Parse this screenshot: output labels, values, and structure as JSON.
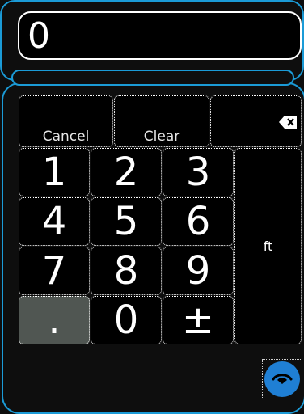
{
  "display": {
    "value": "0"
  },
  "function_keys": {
    "cancel": "Cancel",
    "clear": "Clear",
    "backspace_icon": "backspace-icon"
  },
  "digits": {
    "k1": "1",
    "k2": "2",
    "k3": "3",
    "k4": "4",
    "k5": "5",
    "k6": "6",
    "k7": "7",
    "k8": "8",
    "k9": "9",
    "dot": ".",
    "k0": "0",
    "plusminus": "±"
  },
  "unit": {
    "label": "ft"
  },
  "action_button": {
    "icon": "eye-icon"
  },
  "colors": {
    "accent": "#1b9bd7",
    "action": "#1f7fd4",
    "dot_key": "#505652"
  }
}
